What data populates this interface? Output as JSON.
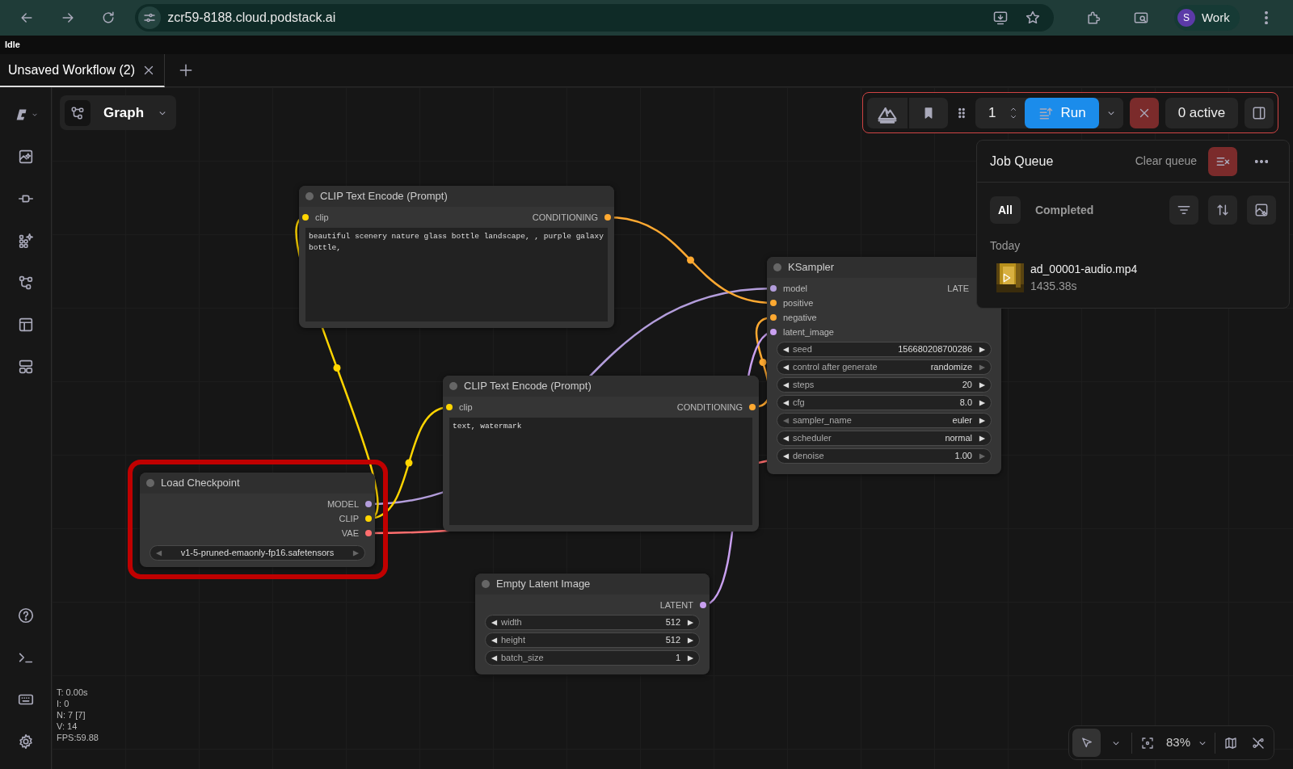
{
  "browser": {
    "url": "zcr59-8188.cloud.podstack.ai",
    "profile": {
      "initial": "S",
      "name": "Work"
    }
  },
  "status": "Idle",
  "tabs": [
    {
      "label": "Unsaved Workflow (2)",
      "selected": true
    }
  ],
  "view_menu": {
    "label": "Graph"
  },
  "toolbar": {
    "batch_count": "1",
    "run_label": "Run",
    "active_label": "0 active"
  },
  "job_queue": {
    "title": "Job Queue",
    "clear_label": "Clear queue",
    "filters": [
      {
        "label": "All",
        "selected": true
      },
      {
        "label": "Completed",
        "selected": false
      }
    ],
    "group": "Today",
    "jobs": [
      {
        "name": "ad_00001-audio.mp4",
        "duration": "1435.38s"
      }
    ]
  },
  "nodes": [
    {
      "title": "CLIP Text Encode (Prompt)",
      "highlighted": false,
      "inputs": [
        {
          "name": "clip",
          "color": "#ffd500"
        }
      ],
      "outputs": [
        {
          "name": "CONDITIONING",
          "color": "#ffa931"
        }
      ],
      "prompt": "beautiful scenery nature glass bottle landscape, , purple galaxy bottle,"
    },
    {
      "title": "KSampler",
      "highlighted": false,
      "inputs": [
        {
          "name": "model",
          "color": "#b39ddb"
        },
        {
          "name": "positive",
          "color": "#ffa931"
        },
        {
          "name": "negative",
          "color": "#ffa931"
        },
        {
          "name": "latent_image",
          "color": "#c9a0f0"
        }
      ],
      "outputs": [
        {
          "name": "LATE"
        }
      ],
      "widgets": [
        {
          "label": "seed",
          "value": "156680208700286",
          "can_decrement": true,
          "can_increment": true
        },
        {
          "label": "control after generate",
          "value": "randomize",
          "can_decrement": true,
          "can_increment": false
        },
        {
          "label": "steps",
          "value": "20",
          "can_decrement": true,
          "can_increment": true
        },
        {
          "label": "cfg",
          "value": "8.0",
          "can_decrement": true,
          "can_increment": true
        },
        {
          "label": "sampler_name",
          "value": "euler",
          "can_decrement": false,
          "can_increment": true
        },
        {
          "label": "scheduler",
          "value": "normal",
          "can_decrement": true,
          "can_increment": true
        },
        {
          "label": "denoise",
          "value": "1.00",
          "can_decrement": true,
          "can_increment": false
        }
      ]
    },
    {
      "title": "CLIP Text Encode (Prompt)",
      "highlighted": false,
      "inputs": [
        {
          "name": "clip",
          "color": "#ffd500"
        }
      ],
      "outputs": [
        {
          "name": "CONDITIONING",
          "color": "#ffa931"
        }
      ],
      "prompt": "text, watermark"
    },
    {
      "title": "Load Checkpoint",
      "highlighted": true,
      "outputs": [
        {
          "name": "MODEL",
          "color": "#b39ddb"
        },
        {
          "name": "CLIP",
          "color": "#ffd500"
        },
        {
          "name": "VAE",
          "color": "#ff6e6e"
        }
      ],
      "widgets": [
        {
          "label": "v1-5-pruned-emaonly-fp16.safetensors",
          "can_decrement": false,
          "can_increment": false
        }
      ]
    },
    {
      "title": "Empty Latent Image",
      "highlighted": false,
      "outputs": [
        {
          "name": "LATENT",
          "color": "#c9a0f0"
        }
      ],
      "widgets": [
        {
          "label": "width",
          "value": "512",
          "can_decrement": true,
          "can_increment": true
        },
        {
          "label": "height",
          "value": "512",
          "can_decrement": true,
          "can_increment": true
        },
        {
          "label": "batch_size",
          "value": "1",
          "can_decrement": true,
          "can_increment": true
        }
      ]
    }
  ],
  "stats": [
    "T: 0.00s",
    "I: 0",
    "N: 7 [7]",
    "V: 14",
    "FPS:59.88"
  ],
  "canvas_controls": {
    "zoom": "83%"
  }
}
